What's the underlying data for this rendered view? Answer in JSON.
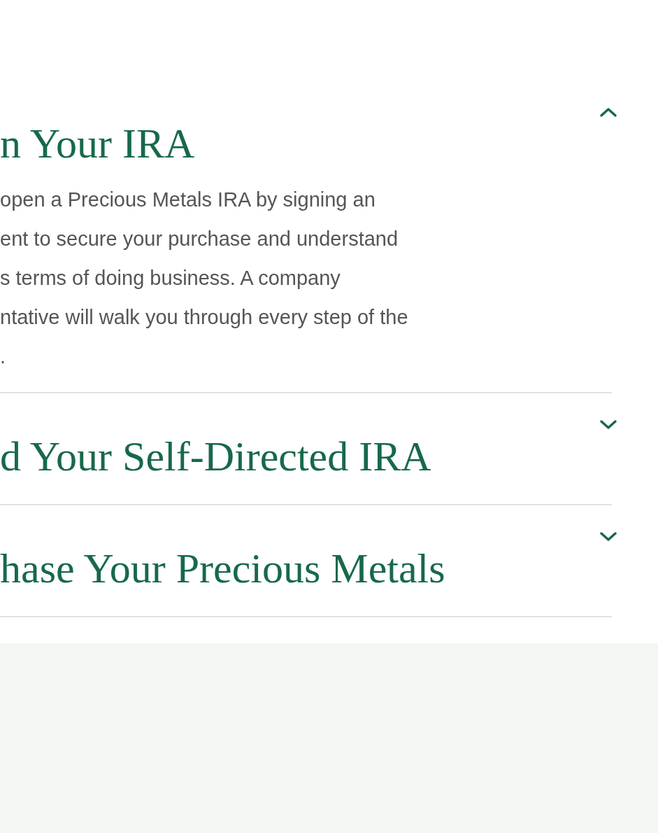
{
  "accordion": [
    {
      "title": "n Your IRA",
      "expanded": true,
      "body_lines": [
        "open a Precious Metals IRA by signing an",
        "ent to secure your purchase and understand",
        "s terms of doing business. A company",
        "ntative will walk you through every step of the",
        "."
      ]
    },
    {
      "title": "d Your Self-Directed IRA",
      "expanded": false
    },
    {
      "title": "hase Your Precious Metals",
      "expanded": false
    }
  ]
}
